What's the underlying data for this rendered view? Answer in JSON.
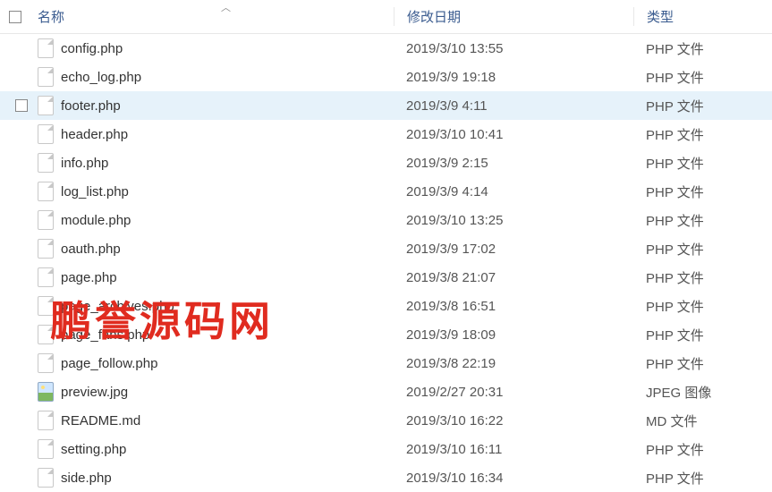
{
  "columns": {
    "name": "名称",
    "date": "修改日期",
    "type": "类型"
  },
  "files": [
    {
      "name": "config.php",
      "date": "2019/3/10 13:55",
      "type": "PHP 文件",
      "icon": "doc",
      "hover": false
    },
    {
      "name": "echo_log.php",
      "date": "2019/3/9 19:18",
      "type": "PHP 文件",
      "icon": "doc",
      "hover": false
    },
    {
      "name": "footer.php",
      "date": "2019/3/9 4:11",
      "type": "PHP 文件",
      "icon": "doc",
      "hover": true
    },
    {
      "name": "header.php",
      "date": "2019/3/10 10:41",
      "type": "PHP 文件",
      "icon": "doc",
      "hover": false
    },
    {
      "name": "info.php",
      "date": "2019/3/9 2:15",
      "type": "PHP 文件",
      "icon": "doc",
      "hover": false
    },
    {
      "name": "log_list.php",
      "date": "2019/3/9 4:14",
      "type": "PHP 文件",
      "icon": "doc",
      "hover": false
    },
    {
      "name": "module.php",
      "date": "2019/3/10 13:25",
      "type": "PHP 文件",
      "icon": "doc",
      "hover": false
    },
    {
      "name": "oauth.php",
      "date": "2019/3/9 17:02",
      "type": "PHP 文件",
      "icon": "doc",
      "hover": false
    },
    {
      "name": "page.php",
      "date": "2019/3/8 21:07",
      "type": "PHP 文件",
      "icon": "doc",
      "hover": false
    },
    {
      "name": "page_archives.php",
      "date": "2019/3/8 16:51",
      "type": "PHP 文件",
      "icon": "doc",
      "hover": false
    },
    {
      "name": "page_fans.php",
      "date": "2019/3/9 18:09",
      "type": "PHP 文件",
      "icon": "doc",
      "hover": false
    },
    {
      "name": "page_follow.php",
      "date": "2019/3/8 22:19",
      "type": "PHP 文件",
      "icon": "doc",
      "hover": false
    },
    {
      "name": "preview.jpg",
      "date": "2019/2/27 20:31",
      "type": "JPEG 图像",
      "icon": "img",
      "hover": false
    },
    {
      "name": "README.md",
      "date": "2019/3/10 16:22",
      "type": "MD 文件",
      "icon": "doc",
      "hover": false
    },
    {
      "name": "setting.php",
      "date": "2019/3/10 16:11",
      "type": "PHP 文件",
      "icon": "doc",
      "hover": false
    },
    {
      "name": "side.php",
      "date": "2019/3/10 16:34",
      "type": "PHP 文件",
      "icon": "doc",
      "hover": false
    }
  ],
  "watermark": "鹏誉源码网"
}
